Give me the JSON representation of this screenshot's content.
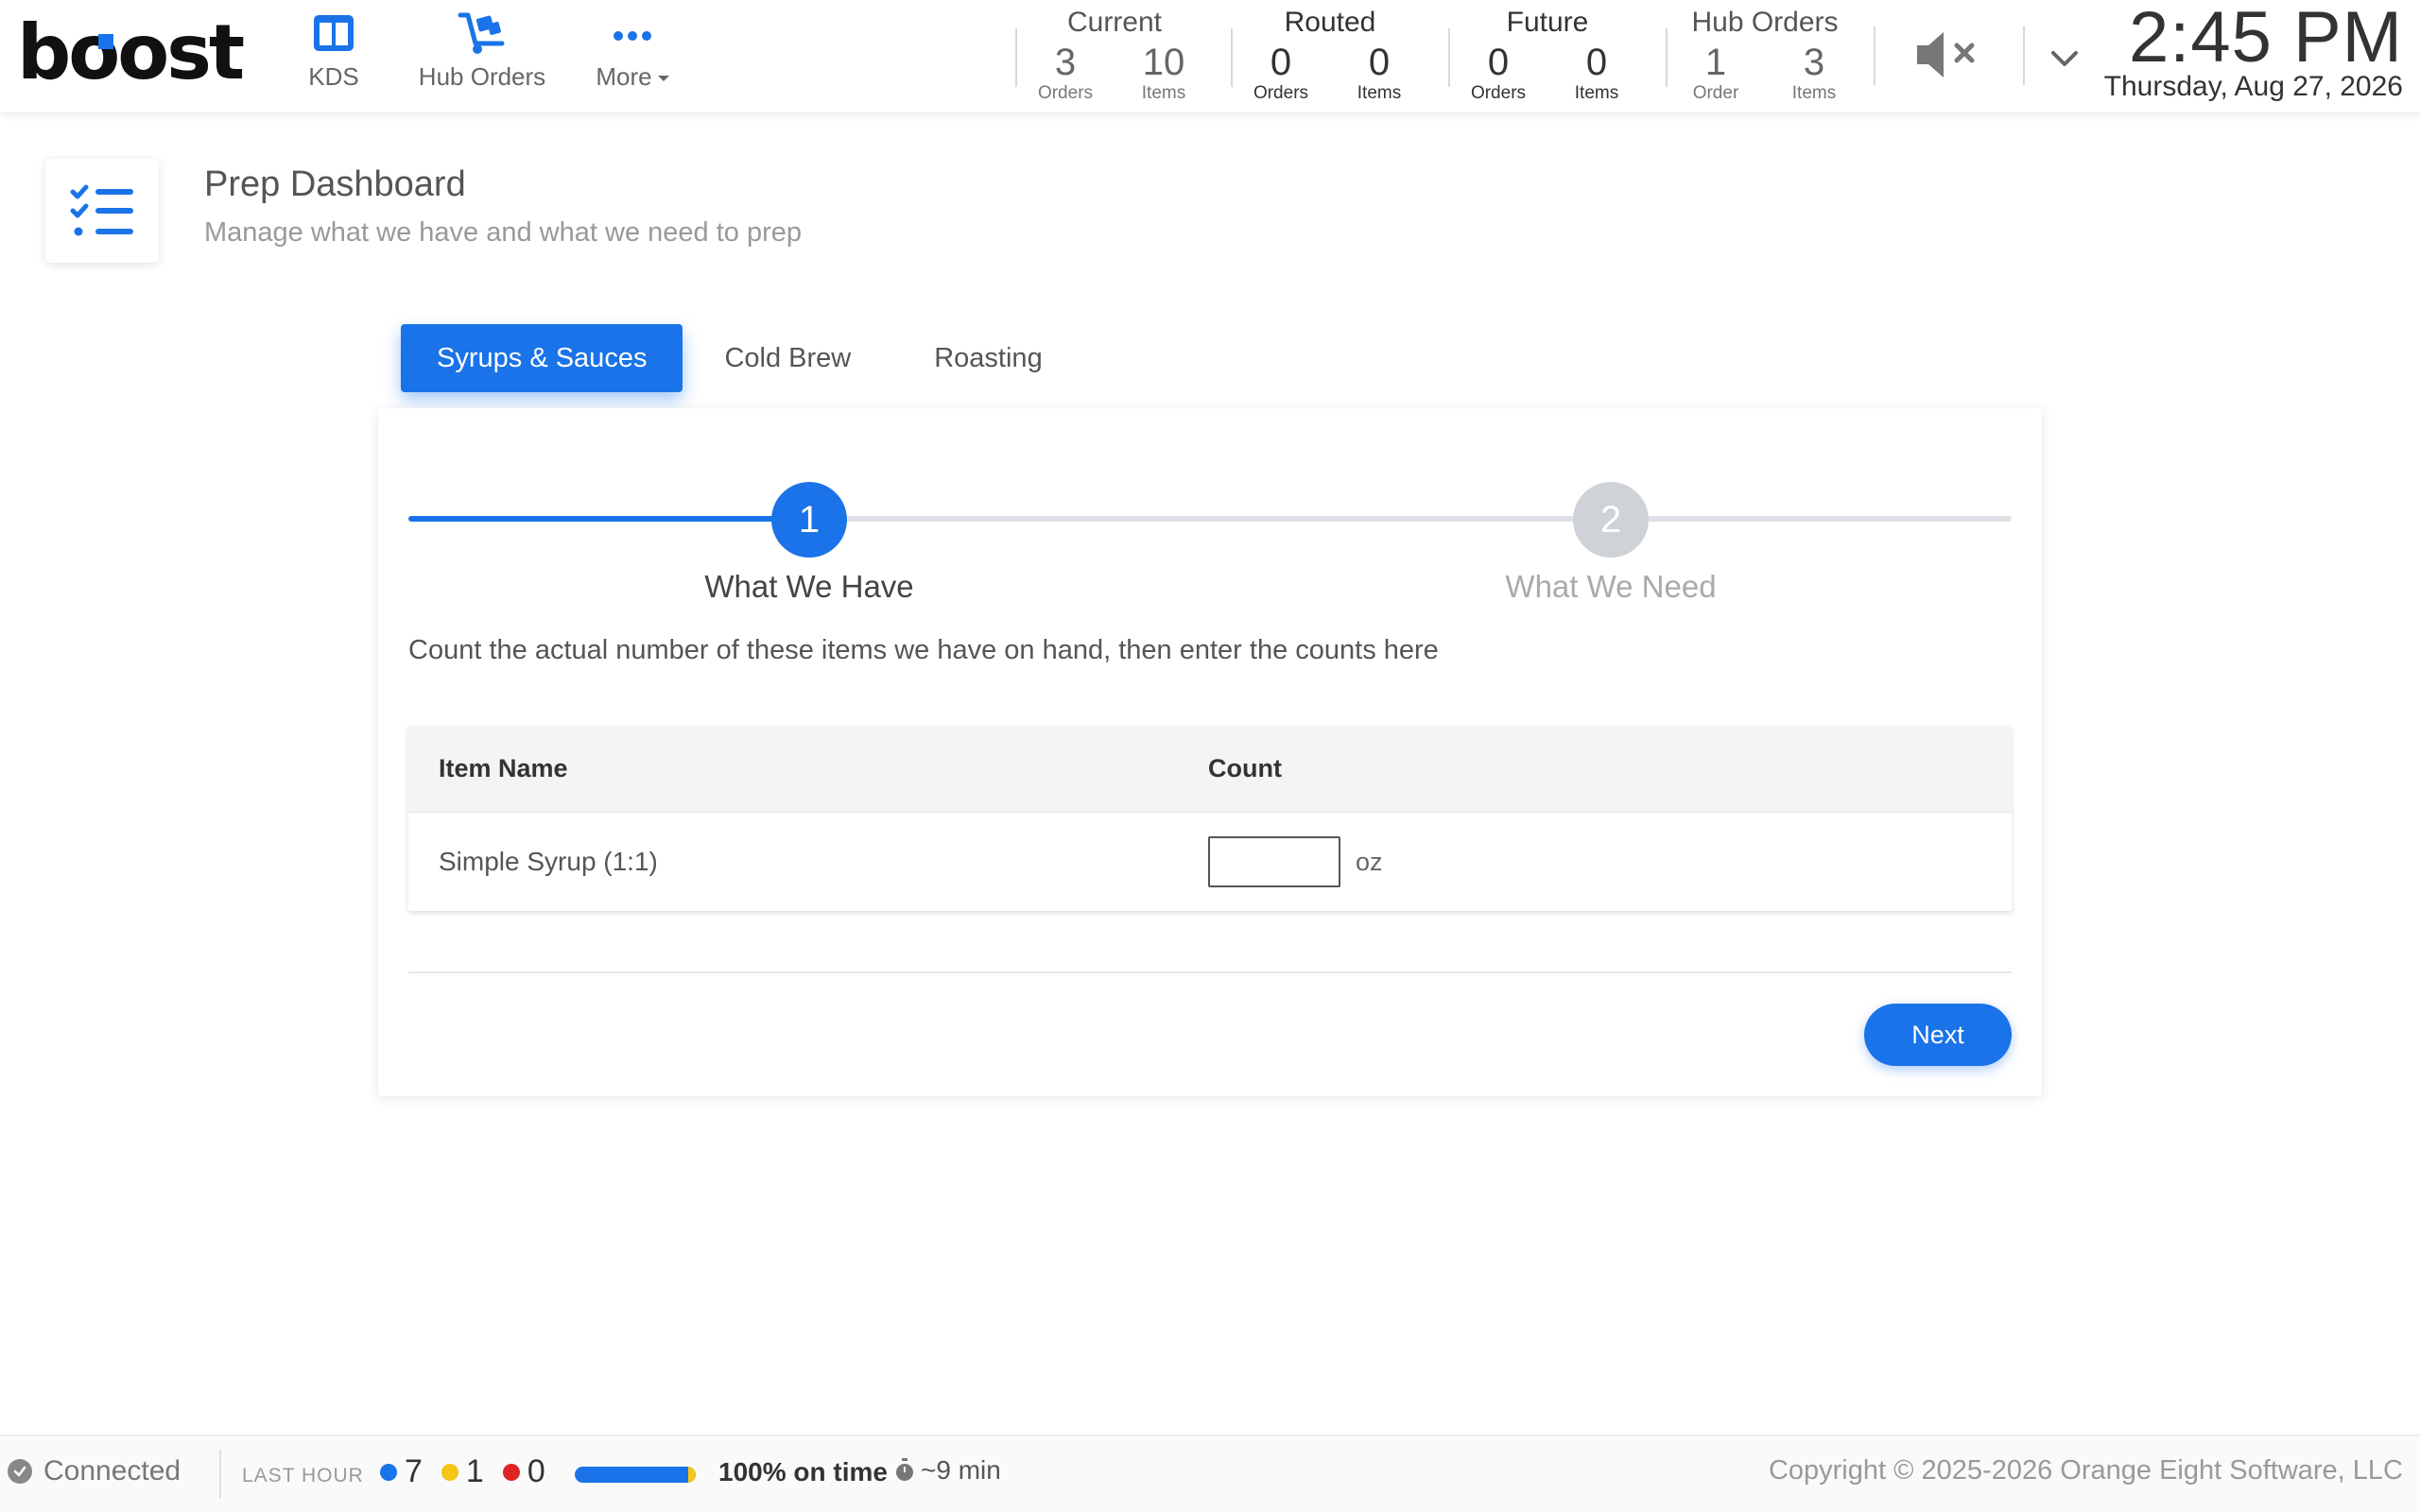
{
  "brand": {
    "logo_text_pre": "b",
    "logo_text_o": "o",
    "logo_text_post": "ost",
    "accent": "#1a73e8"
  },
  "nav": {
    "kds": {
      "label": "KDS",
      "icon": "columns-icon"
    },
    "hub_orders": {
      "label": "Hub Orders",
      "icon": "hand-truck-icon"
    },
    "more": {
      "label": "More",
      "icon": "dots-icon"
    }
  },
  "stats": {
    "current": {
      "title": "Current",
      "orders": "3",
      "orders_label": "Orders",
      "items": "10",
      "items_label": "Items"
    },
    "routed": {
      "title": "Routed",
      "orders": "0",
      "orders_label": "Orders",
      "items": "0",
      "items_label": "Items"
    },
    "future": {
      "title": "Future",
      "orders": "0",
      "orders_label": "Orders",
      "items": "0",
      "items_label": "Items"
    },
    "hub_orders": {
      "title": "Hub Orders",
      "orders": "1",
      "orders_label": "Order",
      "items": "3",
      "items_label": "Items"
    }
  },
  "clock": {
    "time": "2:45 PM",
    "date": "Thursday, Aug 27, 2026"
  },
  "page": {
    "title": "Prep Dashboard",
    "subtitle": "Manage what we have and what we need to prep",
    "icon": "checklist-icon"
  },
  "tabs": [
    {
      "label": "Syrups & Sauces",
      "active": true
    },
    {
      "label": "Cold Brew",
      "active": false
    },
    {
      "label": "Roasting",
      "active": false
    }
  ],
  "stepper": {
    "steps": [
      {
        "number": "1",
        "label": "What We Have",
        "active": true
      },
      {
        "number": "2",
        "label": "What We Need",
        "active": false
      }
    ]
  },
  "instruction": "Count the actual number of these items we have on hand, then enter the counts here",
  "table": {
    "headers": {
      "name": "Item Name",
      "count": "Count"
    },
    "rows": [
      {
        "name": "Simple Syrup (1:1)",
        "count_value": "",
        "unit": "oz"
      }
    ]
  },
  "actions": {
    "next_label": "Next"
  },
  "footer": {
    "status": "Connected",
    "last_hour_label": "LAST HOUR",
    "count_blue": "7",
    "count_yellow": "1",
    "count_red": "0",
    "on_time_fraction": 0.94,
    "on_time_text": "100% on time",
    "avg_time": "~9 min",
    "copyright": "Copyright © 2025-2026 Orange Eight Software, LLC",
    "colors": {
      "blue": "#1a73e8",
      "yellow": "#f5c518",
      "red": "#e02424"
    }
  }
}
